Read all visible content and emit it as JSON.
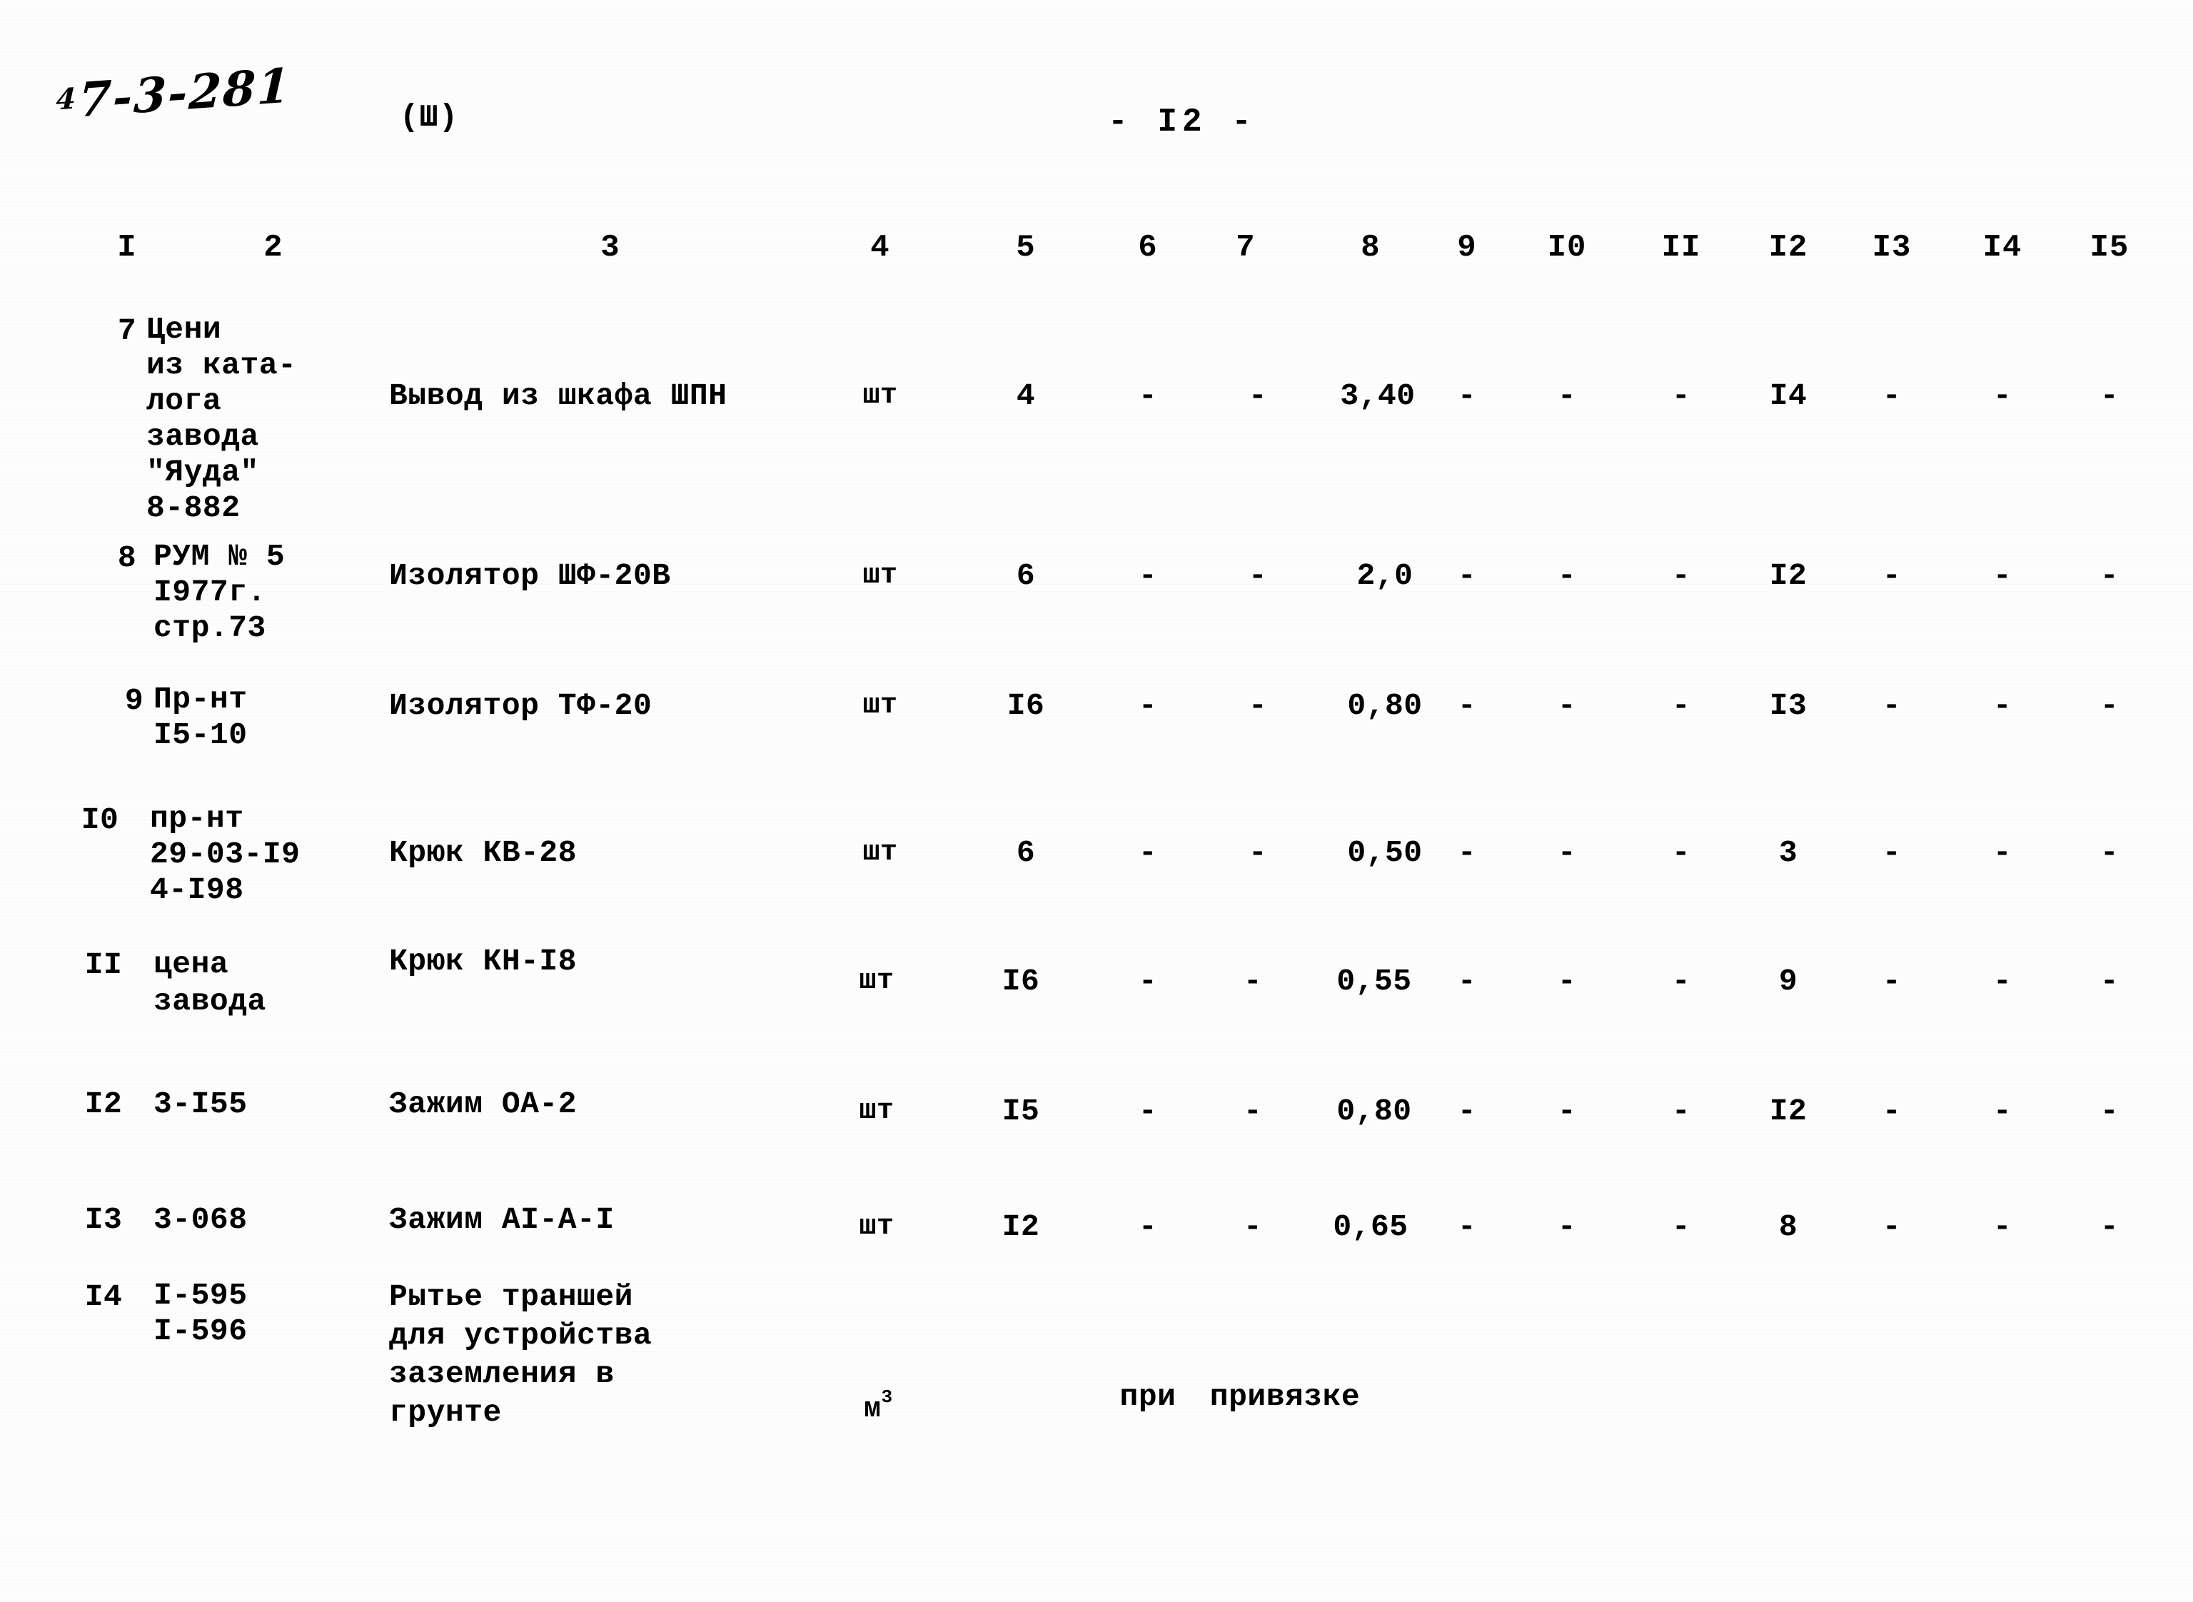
{
  "header": {
    "handwritten_prefix": "4",
    "handwritten_code": "7-3-281",
    "section_mark": "(Ш)",
    "page_number": "- I2 -"
  },
  "table": {
    "column_headers": [
      "I",
      "2",
      "3",
      "4",
      "5",
      "6",
      "7",
      "8",
      "9",
      "I0",
      "II",
      "I2",
      "I3",
      "I4",
      "I5"
    ],
    "rows": [
      {
        "c1": "7",
        "c2": "Цени\nиз ката-\nлога\nзавода\n\"Яуда\"\n8-882",
        "c3": "Вывод из шкафа ШПН",
        "c4": "шт",
        "c5": "4",
        "c6": "-",
        "c7": "-",
        "c8": "3,40",
        "c9": "-",
        "c10": "-",
        "c11": "-",
        "c12": "I4",
        "c13": "-",
        "c14": "-",
        "c15": "-"
      },
      {
        "c1": "8",
        "c2": "РУМ № 5\nI977г.\nстр.73",
        "c3": "Изолятор ШФ-20В",
        "c4": "шт",
        "c5": "6",
        "c6": "-",
        "c7": "-",
        "c8": "2,0",
        "c9": "-",
        "c10": "-",
        "c11": "-",
        "c12": "I2",
        "c13": "-",
        "c14": "-",
        "c15": "-"
      },
      {
        "c1": "9",
        "c2": "Пр-нт\nI5-10",
        "c3": "Изолятор  ТФ-20",
        "c4": "шт",
        "c5": "I6",
        "c6": "-",
        "c7": "-",
        "c8": "0,80",
        "c9": "-",
        "c10": "-",
        "c11": "-",
        "c12": "I3",
        "c13": "-",
        "c14": "-",
        "c15": "-"
      },
      {
        "c1": "I0",
        "c2": "пр-нт\n29-03-I9\n4-I98",
        "c3": "Крюк КВ-28",
        "c4": "шт",
        "c5": "6",
        "c6": "-",
        "c7": "-",
        "c8": "0,50",
        "c9": "-",
        "c10": "-",
        "c11": "-",
        "c12": "3",
        "c13": "-",
        "c14": "-",
        "c15": "-"
      },
      {
        "c1": "II",
        "c2": "цена\nзавода",
        "c3": "Крюк КН-I8",
        "c4": "шт",
        "c5": "I6",
        "c6": "-",
        "c7": "-",
        "c8": "0,55",
        "c9": "-",
        "c10": "-",
        "c11": "-",
        "c12": "9",
        "c13": "-",
        "c14": "-",
        "c15": "-"
      },
      {
        "c1": "I2",
        "c2": "3-I55",
        "c3": "Зажим ОА-2",
        "c4": "шт",
        "c5": "I5",
        "c6": "-",
        "c7": "-",
        "c8": "0,80",
        "c9": "-",
        "c10": "-",
        "c11": "-",
        "c12": "I2",
        "c13": "-",
        "c14": "-",
        "c15": "-"
      },
      {
        "c1": "I3",
        "c2": "3-068",
        "c3": "Зажим АI-А-I",
        "c4": "шт",
        "c5": "I2",
        "c6": "-",
        "c7": "-",
        "c8": "0,65",
        "c9": "-",
        "c10": "-",
        "c11": "-",
        "c12": "8",
        "c13": "-",
        "c14": "-",
        "c15": "-"
      },
      {
        "c1": "I4",
        "c2": "I-595\nI-596",
        "c3": "Рытье траншей\nдля устройства\nзаземления в\nгрунте",
        "c4": "м",
        "c4_sup": "3",
        "c5": "",
        "c6": "при",
        "c7": "привязке",
        "c8": "",
        "c9": "",
        "c10": "",
        "c11": "",
        "c12": "",
        "c13": "",
        "c14": "",
        "c15": ""
      }
    ]
  }
}
